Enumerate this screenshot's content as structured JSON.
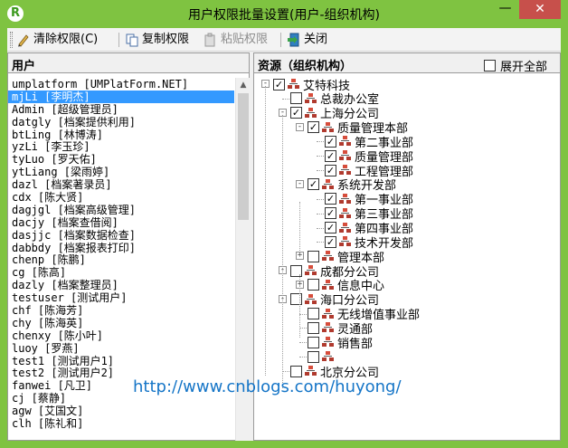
{
  "window": {
    "title": "用户权限批量设置(用户-组织机构)",
    "app_icon_letter": "R",
    "minimize_glyph": "—",
    "close_glyph": "✕"
  },
  "toolbar": {
    "clear_label": "清除权限(C)",
    "copy_label": "复制权限",
    "paste_label": "粘贴权限",
    "close_label": "关闭"
  },
  "users_panel": {
    "title": "用户",
    "items": [
      "umplatform [UMPlatForm.NET]",
      "mjLi [李明杰]",
      "Admin [超级管理员]",
      "datgly [档案提供利用]",
      "btLing [林博涛]",
      "yzLi [李玉珍]",
      "tyLuo [罗天佑]",
      "ytLiang [梁雨婷]",
      "dazl [档案著录员]",
      "cdx [陈大贤]",
      "dagjgl [档案高级管理]",
      "dacjy [档案查借阅]",
      "dasjjc [档案数据检查]",
      "dabbdy [档案报表打印]",
      "chenp [陈鹏]",
      "cg [陈高]",
      "dazly [档案整理员]",
      "testuser [测试用户]",
      "chf [陈海芳]",
      "chy [陈海英]",
      "chenxy [陈小叶]",
      "luoy [罗燕]",
      "test1 [测试用户1]",
      "test2 [测试用户2]",
      "fanwei [凡卫]",
      "cj [蔡静]",
      "agw [艾国文]",
      "clh [陈礼和]"
    ],
    "selected_index": 1
  },
  "org_panel": {
    "title": "资源（组织机构）",
    "expand_all_label": "展开全部",
    "tree": [
      {
        "label": "艾特科技",
        "level": 0,
        "expander": "-",
        "checked": true
      },
      {
        "label": "总裁办公室",
        "level": 1,
        "expander": "",
        "checked": false
      },
      {
        "label": "上海分公司",
        "level": 1,
        "expander": "-",
        "checked": true
      },
      {
        "label": "质量管理本部",
        "level": 2,
        "expander": "-",
        "checked": true
      },
      {
        "label": "第二事业部",
        "level": 3,
        "expander": "",
        "checked": true
      },
      {
        "label": "质量管理部",
        "level": 3,
        "expander": "",
        "checked": true
      },
      {
        "label": "工程管理部",
        "level": 3,
        "expander": "",
        "checked": true
      },
      {
        "label": "系统开发部",
        "level": 2,
        "expander": "-",
        "checked": true
      },
      {
        "label": "第一事业部",
        "level": 3,
        "expander": "",
        "checked": true
      },
      {
        "label": "第三事业部",
        "level": 3,
        "expander": "",
        "checked": true
      },
      {
        "label": "第四事业部",
        "level": 3,
        "expander": "",
        "checked": true
      },
      {
        "label": "技术开发部",
        "level": 3,
        "expander": "",
        "checked": true
      },
      {
        "label": "管理本部",
        "level": 2,
        "expander": "+",
        "checked": false
      },
      {
        "label": "成都分公司",
        "level": 1,
        "expander": "-",
        "checked": false
      },
      {
        "label": "信息中心",
        "level": 2,
        "expander": "+",
        "checked": false
      },
      {
        "label": "海口分公司",
        "level": 1,
        "expander": "-",
        "checked": false
      },
      {
        "label": "无线增值事业部",
        "level": 2,
        "expander": "",
        "checked": false
      },
      {
        "label": "灵通部",
        "level": 2,
        "expander": "",
        "checked": false
      },
      {
        "label": "销售部",
        "level": 2,
        "expander": "",
        "checked": false
      },
      {
        "label": "",
        "level": 2,
        "expander": "",
        "checked": false
      },
      {
        "label": "北京分公司",
        "level": 1,
        "expander": "",
        "checked": false
      }
    ]
  },
  "watermark": "http://www.cnblogs.com/huyong/",
  "colors": {
    "frame": "#7fc341",
    "selection": "#3399ff",
    "close": "#c7504b",
    "watermark": "#1575c7"
  }
}
